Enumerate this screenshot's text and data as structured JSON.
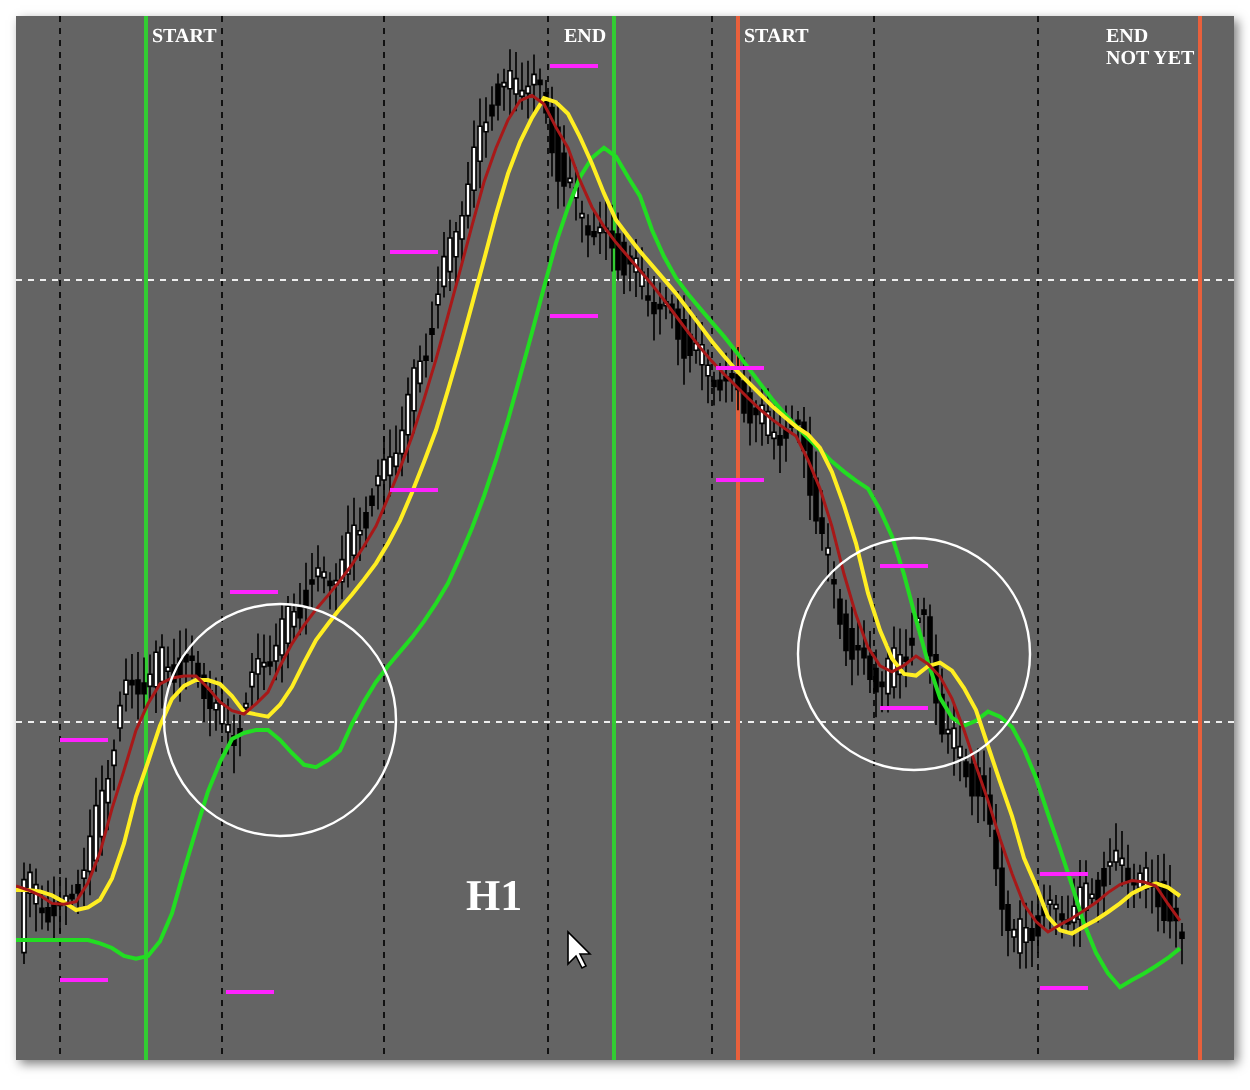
{
  "chart": {
    "timeframe": "H1",
    "markers": [
      {
        "lines": [
          "START"
        ],
        "color": "#33cc33"
      },
      {
        "lines": [
          "END"
        ],
        "color": "#33cc33"
      },
      {
        "lines": [
          "START"
        ],
        "color": "#e8603c"
      },
      {
        "lines": [
          "END",
          "NOT YET"
        ],
        "color": "#e8603c"
      }
    ]
  }
}
